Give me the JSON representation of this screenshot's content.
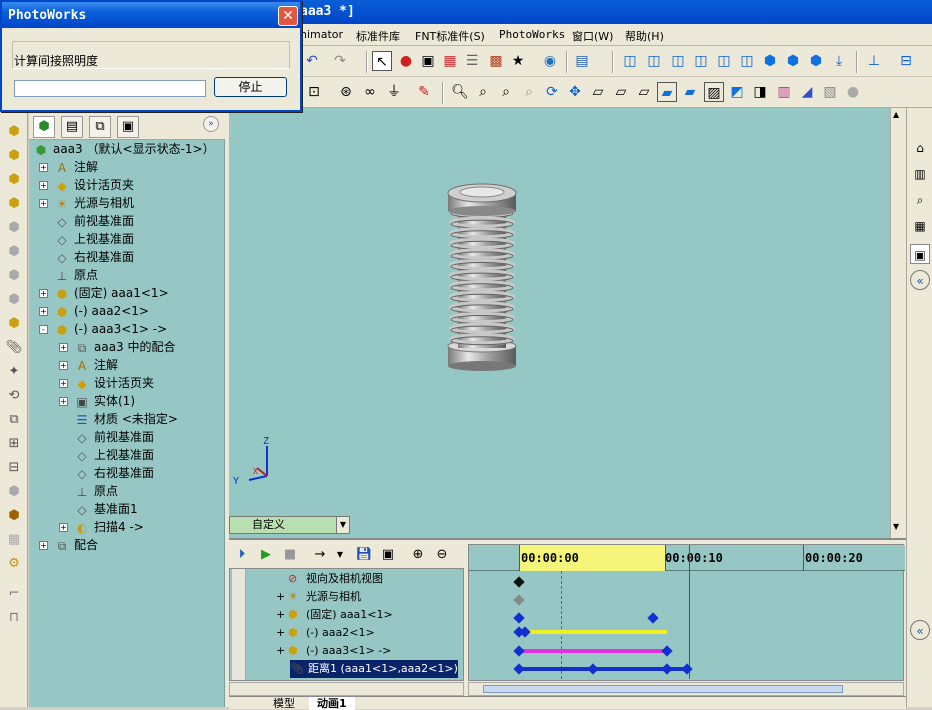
{
  "window": {
    "title": "aaa3 *]"
  },
  "menu": [
    {
      "label": "nimator",
      "mono": false
    },
    {
      "label": "标准件库",
      "mono": false
    },
    {
      "label": "FNT标准件(S)",
      "mono": false
    },
    {
      "label": "PhotoWorks",
      "mono": true
    },
    {
      "label": "窗口(W)",
      "mono": false
    },
    {
      "label": "帮助(H)",
      "mono": false
    }
  ],
  "tree": {
    "root": "aaa3 （默认<显示状态-1>）",
    "items": [
      {
        "label": "注解",
        "icon": "annotation-icon",
        "indent": 0,
        "expander": "+"
      },
      {
        "label": "设计活页夹",
        "icon": "design-binder-icon",
        "indent": 0,
        "expander": "+"
      },
      {
        "label": "光源与相机",
        "icon": "lights-camera-icon",
        "indent": 0,
        "expander": "+"
      },
      {
        "label": "前视基准面",
        "icon": "plane-icon",
        "indent": 0,
        "expander": ""
      },
      {
        "label": "上视基准面",
        "icon": "plane-icon",
        "indent": 0,
        "expander": ""
      },
      {
        "label": "右视基准面",
        "icon": "plane-icon",
        "indent": 0,
        "expander": ""
      },
      {
        "label": "原点",
        "icon": "origin-icon",
        "indent": 0,
        "expander": ""
      },
      {
        "label": "(固定) aaa1<1>",
        "icon": "part-icon",
        "indent": 0,
        "expander": "+"
      },
      {
        "label": "(-) aaa2<1>",
        "icon": "part-icon",
        "indent": 0,
        "expander": "+"
      },
      {
        "label": "(-) aaa3<1> ->",
        "icon": "part-icon",
        "indent": 0,
        "expander": "-"
      },
      {
        "label": "aaa3 中的配合",
        "icon": "mates-icon",
        "indent": 1,
        "expander": "+"
      },
      {
        "label": "注解",
        "icon": "annotation-icon",
        "indent": 1,
        "expander": "+"
      },
      {
        "label": "设计活页夹",
        "icon": "design-binder-icon",
        "indent": 1,
        "expander": "+"
      },
      {
        "label": "实体(1)",
        "icon": "solid-body-icon",
        "indent": 1,
        "expander": "+"
      },
      {
        "label": "材质 <未指定>",
        "icon": "material-icon",
        "indent": 1,
        "expander": ""
      },
      {
        "label": "前视基准面",
        "icon": "plane-icon",
        "indent": 1,
        "expander": ""
      },
      {
        "label": "上视基准面",
        "icon": "plane-icon",
        "indent": 1,
        "expander": ""
      },
      {
        "label": "右视基准面",
        "icon": "plane-icon",
        "indent": 1,
        "expander": ""
      },
      {
        "label": "原点",
        "icon": "origin-icon",
        "indent": 1,
        "expander": ""
      },
      {
        "label": "基准面1",
        "icon": "plane-icon",
        "indent": 1,
        "expander": ""
      },
      {
        "label": "扫描4 ->",
        "icon": "sweep-icon",
        "indent": 1,
        "expander": "+"
      },
      {
        "label": "配合",
        "icon": "mates-icon",
        "indent": 0,
        "expander": "+"
      }
    ]
  },
  "config": {
    "label": "自定义"
  },
  "motion": {
    "times": [
      "00:00:00",
      "00:00:10",
      "00:00:20"
    ],
    "items": [
      {
        "label": "视向及相机视图",
        "expander": ""
      },
      {
        "label": "光源与相机",
        "expander": "+"
      },
      {
        "label": "(固定) aaa1<1>",
        "expander": "+"
      },
      {
        "label": "(-) aaa2<1>",
        "expander": "+"
      },
      {
        "label": "(-) aaa3<1> ->",
        "expander": "+"
      },
      {
        "label": "距离1 (aaa1<1>,aaa2<1>)",
        "expander": ""
      }
    ],
    "tabs": [
      "模型",
      "动画1"
    ]
  },
  "axes": {
    "x": "X",
    "y": "Y",
    "z": "Z"
  },
  "dialog": {
    "title": "PhotoWorks",
    "message": "计算间接照明度",
    "stop": "停止",
    "progress": 0
  },
  "colors": {
    "viewport": "#95c8c4",
    "accent": "#0046c8",
    "yellow_bar": "#f0f020",
    "magenta_bar": "#e030e0",
    "blue_bar": "#1030d0"
  }
}
